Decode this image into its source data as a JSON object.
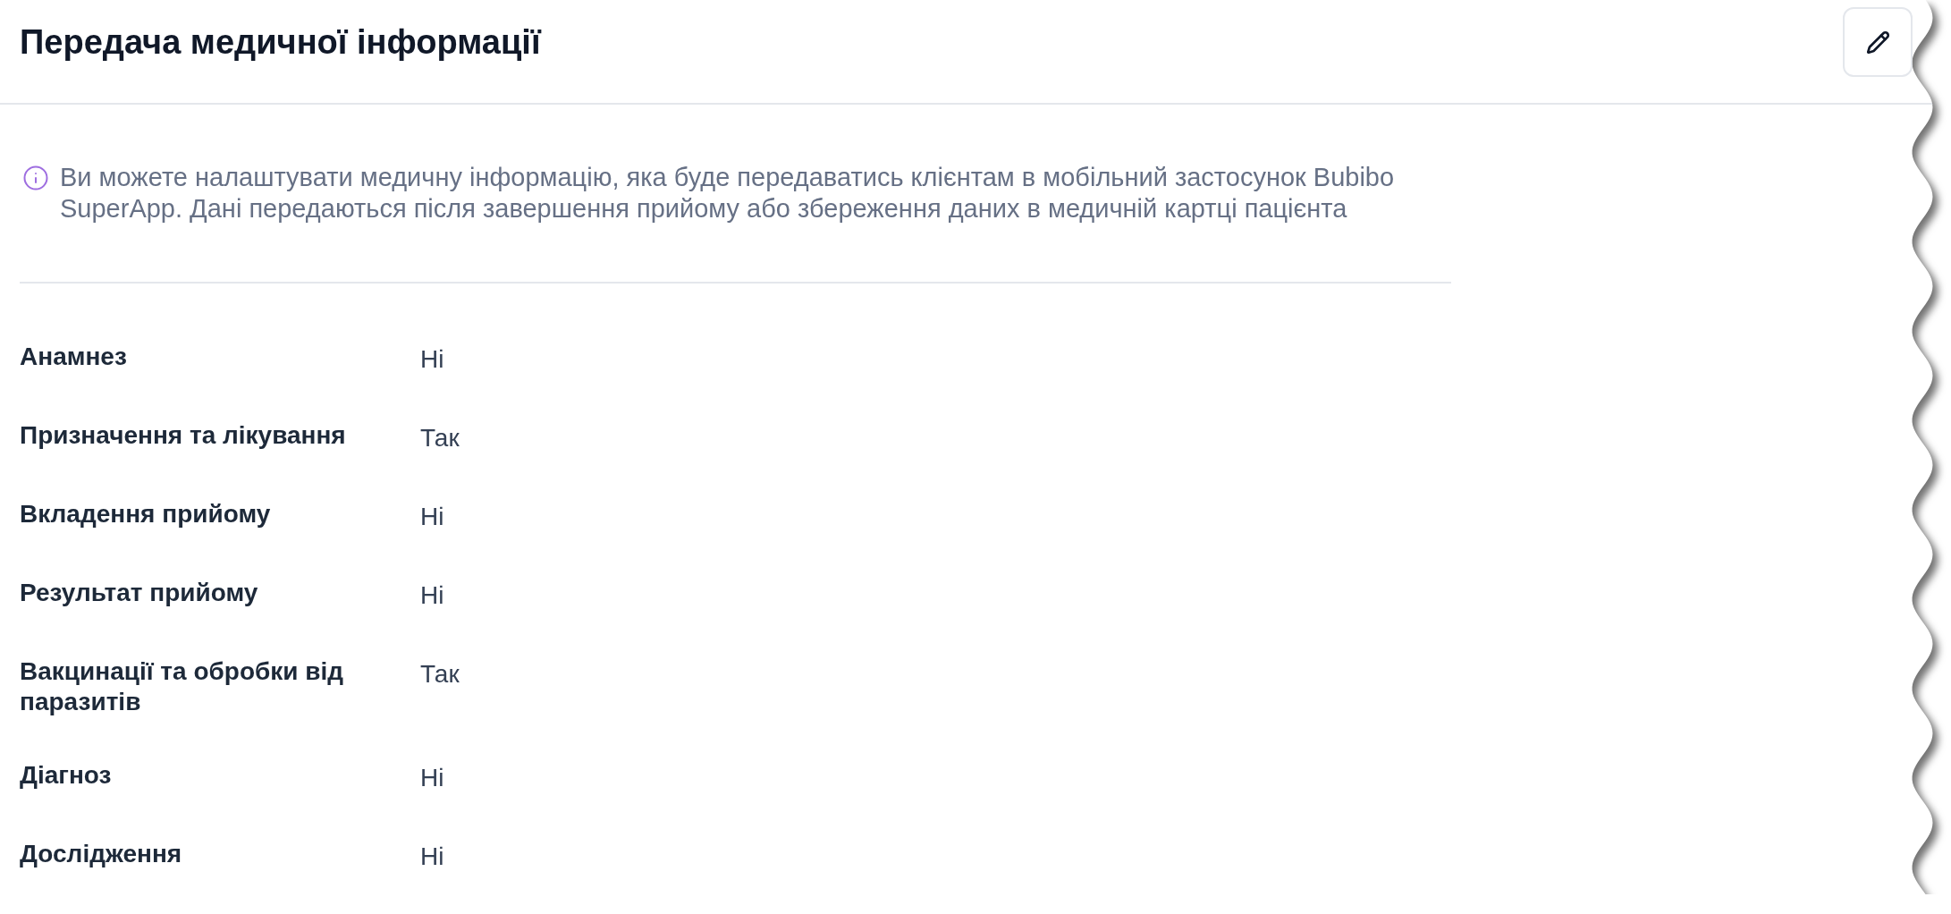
{
  "title": "Передача медичної інформації",
  "info": "Ви можете налаштувати медичну інформацію, яка буде передаватись клієнтам в мобільний застосунок Bubibo SuperApp. Дані передаються після завершення прийому або збереження даних в медичній картці пацієнта",
  "settings": [
    {
      "label": "Анамнез",
      "value": "Ні"
    },
    {
      "label": "Призначення та лікування",
      "value": "Так"
    },
    {
      "label": "Вкладення прийому",
      "value": "Ні"
    },
    {
      "label": "Результат прийому",
      "value": "Ні"
    },
    {
      "label": "Вакцинації та обробки від паразитів",
      "value": "Так"
    },
    {
      "label": "Діагноз",
      "value": "Ні"
    },
    {
      "label": "Дослідження",
      "value": "Ні"
    }
  ]
}
